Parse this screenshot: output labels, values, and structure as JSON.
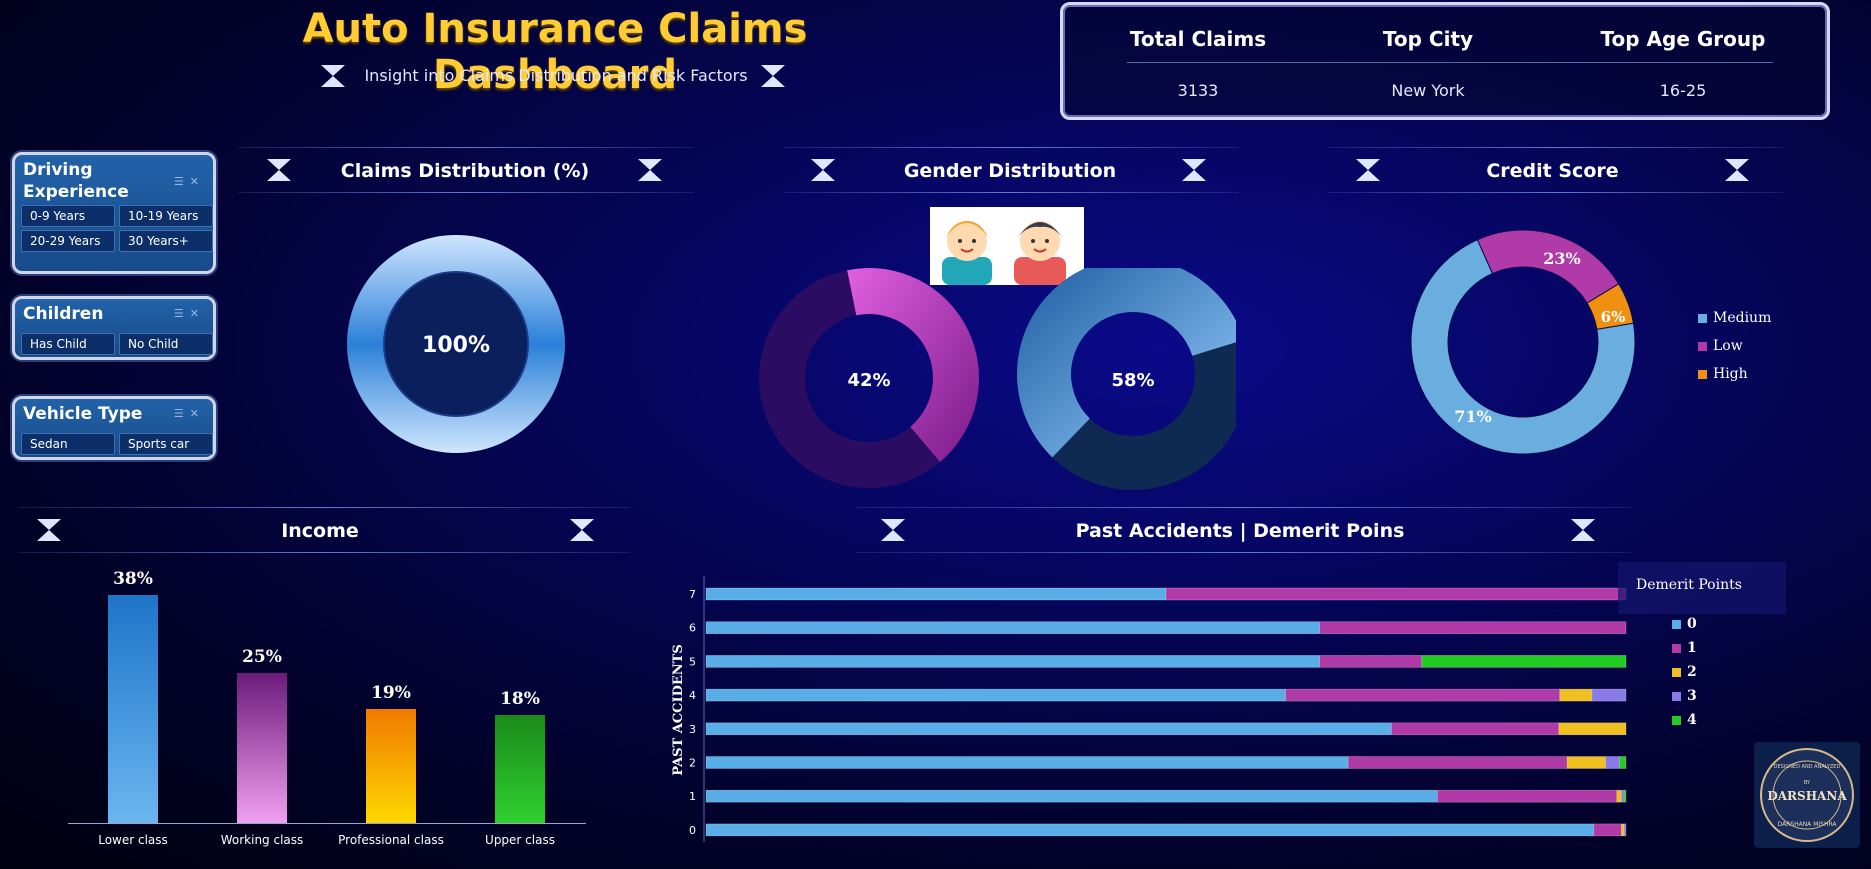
{
  "header": {
    "title": "Auto Insurance Claims Dashboard",
    "subtitle": "Insight into Claims Distribution and Risk Factors"
  },
  "kpis": [
    {
      "label": "Total Claims",
      "value": "3133"
    },
    {
      "label": "Top City",
      "value": "New York"
    },
    {
      "label": "Top Age Group",
      "value": "16-25"
    }
  ],
  "slicers": {
    "driving": {
      "title_line1": "Driving",
      "title_line2": "Experience",
      "options": [
        "0-9 Years",
        "10-19 Years",
        "20-29 Years",
        "30 Years+"
      ]
    },
    "children": {
      "title": "Children",
      "options": [
        "Has Child",
        "No Child"
      ]
    },
    "vehicle": {
      "title": "Vehicle Type",
      "options": [
        "Sedan",
        "Sports car"
      ]
    }
  },
  "panels": {
    "claims": "Claims Distribution (%)",
    "gender": "Gender Distribution",
    "credit": "Credit Score",
    "income": "Income",
    "accidents": "Past Accidents | Demerit Poins"
  },
  "claims_donut": {
    "label": "100%",
    "value": 100
  },
  "gender_donuts": [
    {
      "label": "42%",
      "value": 42,
      "color": "#c040c0"
    },
    {
      "label": "58%",
      "value": 58,
      "color": "#3a7ec8"
    }
  ],
  "credit_donut": {
    "slices": [
      {
        "name": "Medium",
        "value": 71,
        "label": "71%",
        "color": "#6aaee0"
      },
      {
        "name": "Low",
        "value": 23,
        "label": "23%",
        "color": "#b03aa8"
      },
      {
        "name": "High",
        "value": 6,
        "label": "6%",
        "color": "#f09010"
      }
    ]
  },
  "income_chart": {
    "type": "bar",
    "categories": [
      "Lower class",
      "Working class",
      "Professional class",
      "Upper class"
    ],
    "values": [
      38,
      25,
      19,
      18
    ],
    "labels": [
      "38%",
      "25%",
      "19%",
      "18%"
    ],
    "colors": [
      "#3a8fd8",
      "#b44aa8",
      "#ff9a00",
      "#22b222"
    ]
  },
  "chart_data": {
    "type": "bar",
    "orientation": "horizontal",
    "stacked": true,
    "ylabel": "PAST ACCIDENTS",
    "categories": [
      "7",
      "6",
      "5",
      "4",
      "3",
      "2",
      "1",
      "0"
    ],
    "legend_title": "Demerit Points",
    "series": [
      {
        "name": "0",
        "color": "#5aaee8",
        "values": [
          50,
          66.7,
          66.7,
          63,
          74.5,
          69.8,
          79.5,
          96.5
        ]
      },
      {
        "name": "1",
        "color": "#b03aa8",
        "values": [
          50,
          33.3,
          11.1,
          29.8,
          18.2,
          23.8,
          19.5,
          3
        ]
      },
      {
        "name": "2",
        "color": "#f0c020",
        "values": [
          0,
          0,
          0,
          3.5,
          7.3,
          4.2,
          0.5,
          0.3
        ]
      },
      {
        "name": "3",
        "color": "#8a7ae8",
        "values": [
          0,
          0,
          0,
          3.7,
          0,
          1.5,
          0.3,
          0.2
        ]
      },
      {
        "name": "4",
        "color": "#22cc22",
        "values": [
          0,
          0,
          22.2,
          0,
          0,
          0.7,
          0.2,
          0
        ]
      }
    ]
  },
  "logo": {
    "top": "DESIGNED AND ANALYZED",
    "by": "BY",
    "name": "DARSHANA",
    "bottom": "DARSHANA MISHRA"
  }
}
